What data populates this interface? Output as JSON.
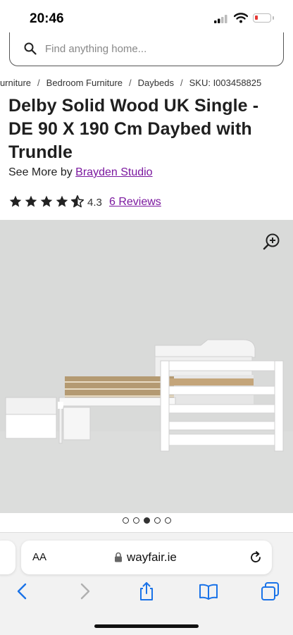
{
  "status_bar": {
    "time": "20:46"
  },
  "search": {
    "placeholder": "Find anything home..."
  },
  "breadcrumb": [
    "Furniture",
    "Bedroom Furniture",
    "Daybeds",
    "SKU: I003458825"
  ],
  "product": {
    "title": "Delby Solid Wood UK Single - DE 90 X 190 Cm Daybed with Trundle",
    "see_more_prefix": "See More by",
    "brand": "Brayden Studio",
    "rating": "4.3",
    "rating_value": 4.3,
    "rating_max": 5,
    "reviews": "6 Reviews"
  },
  "gallery": {
    "image_count": 5,
    "active_index": 2
  },
  "browser": {
    "text_size_label": "AA",
    "url": "wayfair.ie"
  },
  "icons": [
    "search-icon",
    "star-icon",
    "zoom-in-icon",
    "lock-icon",
    "reload-icon",
    "back-icon",
    "forward-icon",
    "share-icon",
    "bookmarks-icon",
    "tabs-icon"
  ],
  "colors": {
    "link": "#7b189f",
    "image_background": "#d9dad9",
    "battery_low": "#e53935"
  }
}
